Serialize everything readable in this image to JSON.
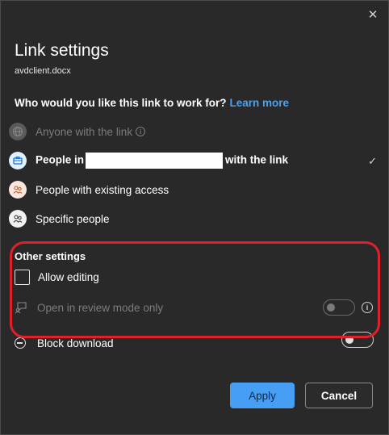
{
  "dialog": {
    "title": "Link settings",
    "filename": "avdclient.docx",
    "close_glyph": "✕"
  },
  "question": {
    "text": "Who would you like this link to work for?",
    "link_label": "Learn more"
  },
  "options": [
    {
      "id": "anyone",
      "label": "Anyone with the link",
      "icon": "globe-icon",
      "state": "disabled"
    },
    {
      "id": "org",
      "label_prefix": "People in",
      "label_suffix": "with the link",
      "icon": "organization-icon",
      "state": "selected"
    },
    {
      "id": "existing",
      "label": "People with existing access",
      "icon": "people-icon",
      "state": "enabled"
    },
    {
      "id": "specific",
      "label": "Specific people",
      "icon": "people-icon",
      "state": "enabled"
    }
  ],
  "other_settings": {
    "title": "Other settings",
    "allow_editing": {
      "label": "Allow editing",
      "checked": false
    },
    "review_mode": {
      "label": "Open in review mode only",
      "enabled": false,
      "on": false
    },
    "block_download": {
      "label": "Block download",
      "on": true
    }
  },
  "buttons": {
    "apply": "Apply",
    "cancel": "Cancel"
  },
  "colors": {
    "accent": "#479ef5",
    "link": "#4aa3f0",
    "highlight": "#e0202b",
    "background": "#292929"
  }
}
